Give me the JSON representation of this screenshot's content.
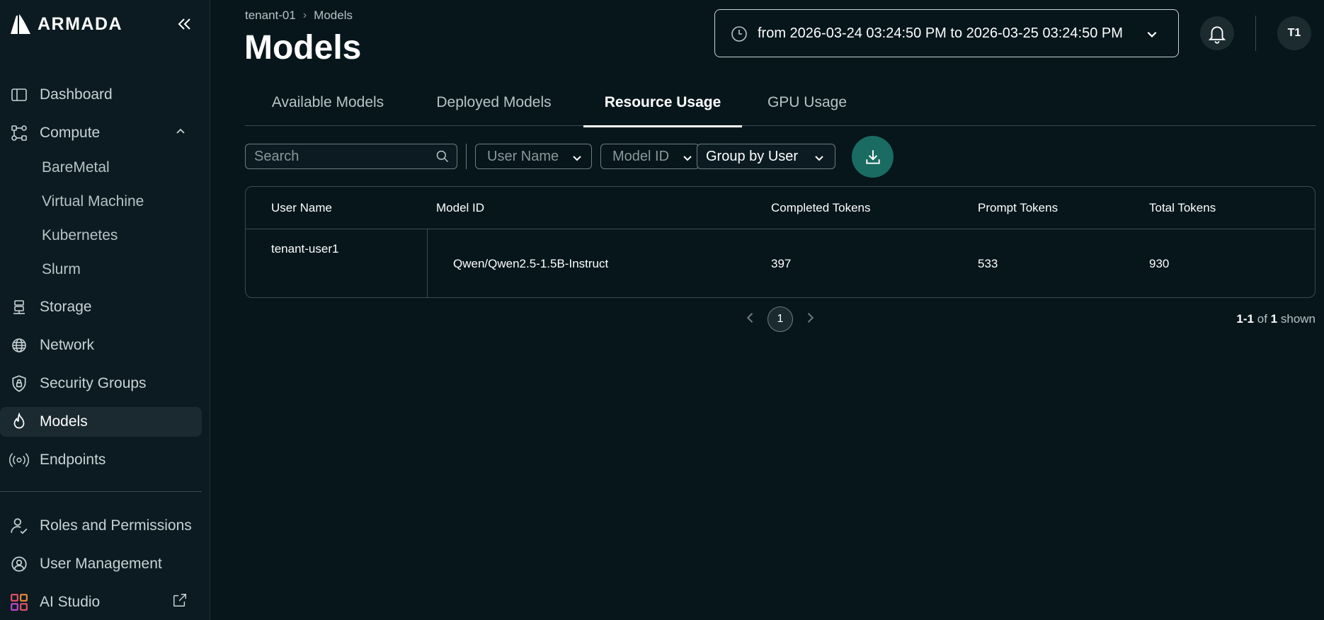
{
  "app": {
    "brand": "ARMADA"
  },
  "sidebar": {
    "items": [
      {
        "label": "Dashboard",
        "icon": "sidebar-panel-icon"
      },
      {
        "label": "Compute",
        "icon": "compute-nodes-icon"
      },
      {
        "label": "Storage",
        "icon": "storage-icon"
      },
      {
        "label": "Network",
        "icon": "globe-icon"
      },
      {
        "label": "Security Groups",
        "icon": "shield-lock-icon"
      },
      {
        "label": "Models",
        "icon": "flame-icon"
      },
      {
        "label": "Endpoints",
        "icon": "broadcast-icon"
      },
      {
        "label": "Roles and Permissions",
        "icon": "user-check-icon"
      },
      {
        "label": "User Management",
        "icon": "user-gear-icon"
      },
      {
        "label": "AI Studio",
        "icon": "grid-apps-icon"
      }
    ],
    "compute_sub": [
      "BareMetal",
      "Virtual Machine",
      "Kubernetes",
      "Slurm"
    ],
    "active": "Models"
  },
  "breadcrumb": {
    "tenant": "tenant-01",
    "current": "Models"
  },
  "page": {
    "title": "Models"
  },
  "date_range": {
    "text": "from 2026-03-24 03:24:50 PM to 2026-03-25 03:24:50 PM"
  },
  "avatar": {
    "initials": "T1"
  },
  "tabs": [
    {
      "label": "Available Models",
      "active": false
    },
    {
      "label": "Deployed Models",
      "active": false
    },
    {
      "label": "Resource Usage",
      "active": true
    },
    {
      "label": "GPU Usage",
      "active": false
    }
  ],
  "filters": {
    "search_placeholder": "Search",
    "user_name": "User Name",
    "model_id": "Model ID",
    "group_by": "Group by User"
  },
  "table": {
    "columns": [
      "User Name",
      "Model ID",
      "Completed Tokens",
      "Prompt Tokens",
      "Total Tokens"
    ],
    "rows": [
      {
        "user": "tenant-user1",
        "model": "Qwen/Qwen2.5-1.5B-Instruct",
        "completed": "397",
        "prompt": "533",
        "total": "930"
      }
    ]
  },
  "pagination": {
    "page": "1",
    "range": "1-1",
    "of": "of",
    "total": "1",
    "suffix": "shown"
  },
  "colors": {
    "accent": "#1a6b62",
    "background": "#06161b",
    "sidebar": "#0b1b21"
  }
}
